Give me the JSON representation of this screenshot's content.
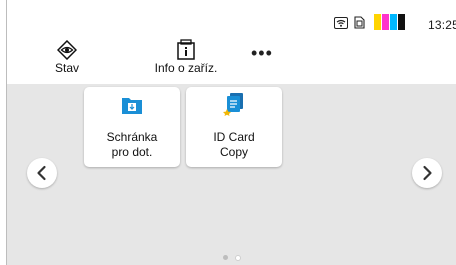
{
  "status": {
    "time": "13:25",
    "icons": [
      "wifi-icon",
      "sd-card-icon",
      "toner-icon"
    ],
    "toner_colors": [
      "#ffd400",
      "#ff33cc",
      "#00b7ff",
      "#111111"
    ]
  },
  "toolbar": {
    "status_label": "Stav",
    "device_info_label": "Info o zaříz.",
    "more_label": "•••"
  },
  "apps": [
    {
      "label_line1": "Schránka",
      "label_line2": "pro dot.",
      "icon": "inbox-folder-icon"
    },
    {
      "label_line1": "ID Card",
      "label_line2": "Copy",
      "icon": "id-card-copy-icon"
    }
  ],
  "pager": {
    "pages": 2,
    "current": 1
  },
  "colors": {
    "accent": "#1a8fd6",
    "star": "#f2b705",
    "background": "#e6e6e6"
  }
}
